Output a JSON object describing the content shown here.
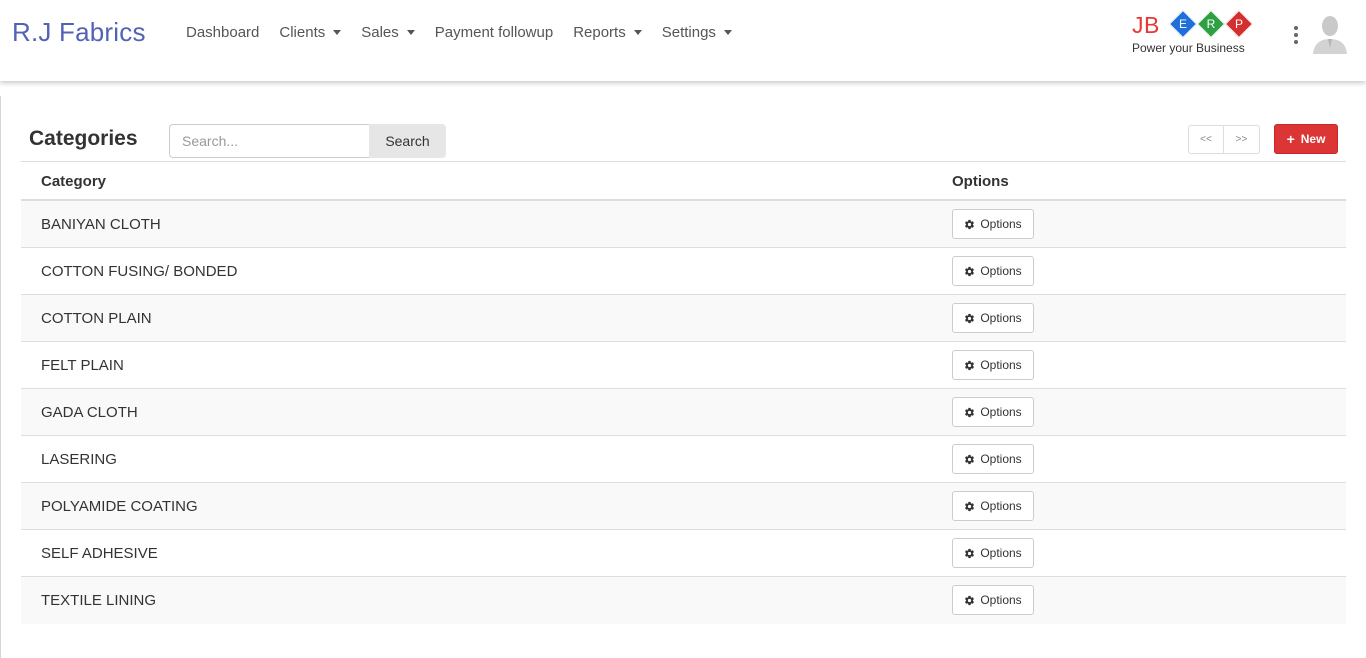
{
  "brand": "R.J Fabrics",
  "nav": [
    {
      "label": "Dashboard",
      "dropdown": false
    },
    {
      "label": "Clients",
      "dropdown": true
    },
    {
      "label": "Sales",
      "dropdown": true
    },
    {
      "label": "Payment followup",
      "dropdown": false
    },
    {
      "label": "Reports",
      "dropdown": true
    },
    {
      "label": "Settings",
      "dropdown": true
    }
  ],
  "logo": {
    "prefix": "JB",
    "letters": [
      "E",
      "R",
      "P"
    ],
    "letter_colors": [
      "#1e6fd9",
      "#2ea043",
      "#d32f2f"
    ],
    "tagline": "Power your Business"
  },
  "page": {
    "title": "Categories",
    "search_placeholder": "Search...",
    "search_button": "Search",
    "pager_prev": "<<",
    "pager_next": ">>",
    "new_button": "New"
  },
  "table": {
    "headers": {
      "category": "Category",
      "options": "Options"
    },
    "option_button_label": "Options",
    "rows": [
      "BANIYAN CLOTH",
      "COTTON FUSING/ BONDED",
      "COTTON PLAIN",
      "FELT PLAIN",
      "GADA CLOTH",
      "LASERING",
      "POLYAMIDE COATING",
      "SELF ADHESIVE",
      "TEXTILE LINING"
    ]
  },
  "colors": {
    "brand": "#5462b6",
    "new_button": "#dc3535",
    "row_striped": "#f9f9f9"
  },
  "icons": {
    "caret": "caret-down-icon",
    "options": "gear-icon",
    "menu": "kebab-icon",
    "avatar": "user-avatar-icon",
    "new": "plus-icon"
  }
}
